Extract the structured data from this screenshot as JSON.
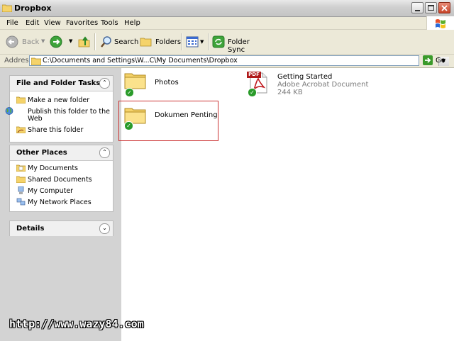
{
  "window": {
    "title": "Dropbox"
  },
  "menu": {
    "items": [
      "File",
      "Edit",
      "View",
      "Favorites",
      "Tools",
      "Help"
    ]
  },
  "toolbar": {
    "back_label": "Back",
    "search_label": "Search",
    "folders_label": "Folders",
    "folder_sync_label": "Folder Sync"
  },
  "address": {
    "label": "Address",
    "value": "C:\\Documents and Settings\\W...C\\My Documents\\Dropbox",
    "go_label": "Go"
  },
  "left_pane": {
    "file_folder_tasks": {
      "title": "File and Folder Tasks",
      "items": [
        "Make a new folder",
        "Publish this folder to the Web",
        "Share this folder"
      ]
    },
    "other_places": {
      "title": "Other Places",
      "items": [
        "My Documents",
        "Shared Documents",
        "My Computer",
        "My Network Places"
      ]
    },
    "details": {
      "title": "Details"
    }
  },
  "files": [
    {
      "name": "Photos",
      "type": "folder",
      "synced": true
    },
    {
      "name": "Dokumen Penting",
      "type": "folder",
      "synced": true,
      "selected": true
    },
    {
      "name": "Getting Started",
      "type": "Adobe Acrobat Document",
      "size": "244 KB",
      "synced": true,
      "icon_label": "PDF"
    }
  ],
  "watermark": "http://www.wazy84.com",
  "colors": {
    "selection_border": "#cc3333",
    "sync_check": "#2a9b2a",
    "go_arrow": "#3a9a2a"
  }
}
